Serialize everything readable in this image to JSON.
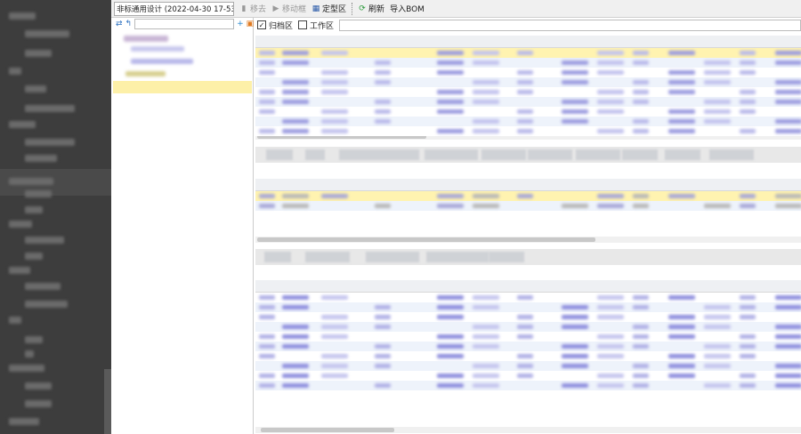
{
  "toolbar": {
    "project_combo": "非标通用设计 (2022-04-30 17-53",
    "remove_label": "移去",
    "move_label": "移动框",
    "finalize_label": "定型区",
    "refresh_label": "刷新",
    "import_bom_label": "导入BOM"
  },
  "filter": {
    "archive_label": "归档区",
    "archive_checked": true,
    "work_label": "工作区",
    "work_checked": false
  },
  "colors": {
    "sidebar": "#3d3d3d",
    "selected_row": "#fff3b0",
    "tree_selected": "#fdf0a8"
  }
}
